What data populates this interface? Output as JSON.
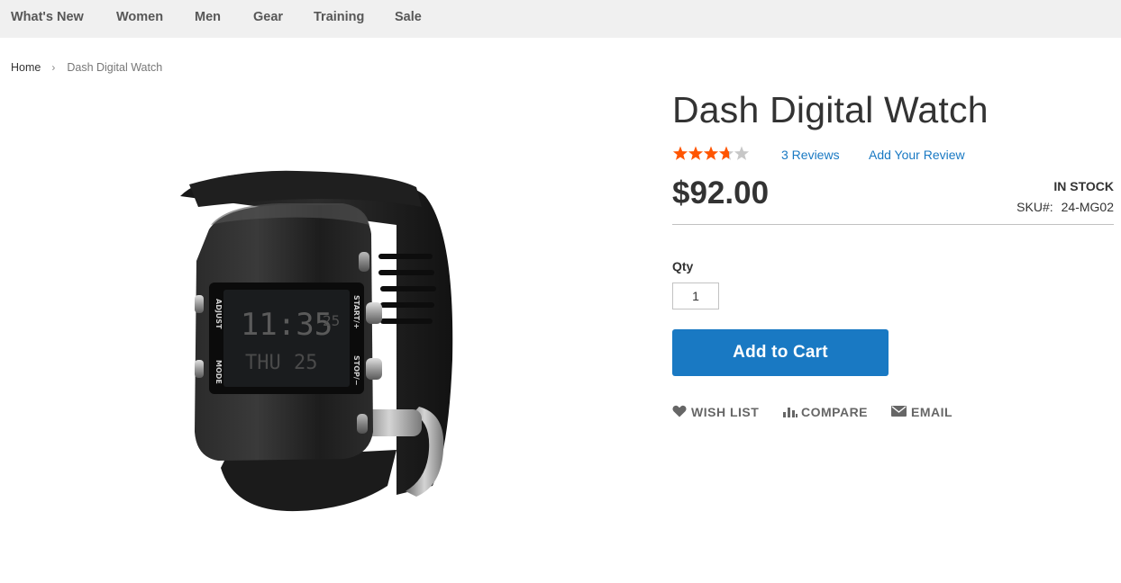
{
  "nav": {
    "items": [
      "What's New",
      "Women",
      "Men",
      "Gear",
      "Training",
      "Sale"
    ]
  },
  "breadcrumb": {
    "home": "Home",
    "separator": "›",
    "current": "Dash Digital Watch"
  },
  "product": {
    "title": "Dash Digital Watch",
    "rating": 3.7,
    "rating_max": 5,
    "reviews_link": "3 Reviews",
    "add_review_link": "Add Your Review",
    "price": "$92.00",
    "stock": "IN STOCK",
    "sku_label": "SKU#:",
    "sku": "24-MG02",
    "image_alt": "Dash Digital Watch"
  },
  "watch_display": {
    "time": "11:35",
    "seconds": "25",
    "day": "THU",
    "date": "25",
    "left_top": "ADJUST",
    "left_bottom": "MODE",
    "right_top": "START/+",
    "right_bottom": "STOP/−"
  },
  "form": {
    "qty_label": "Qty",
    "qty_value": "1",
    "add_to_cart": "Add to Cart"
  },
  "actions": {
    "wishlist": "WISH LIST",
    "compare": "COMPARE",
    "email": "EMAIL"
  },
  "colors": {
    "primary": "#1979c3",
    "star": "#ff5501",
    "star_empty": "#c7c7c7"
  }
}
